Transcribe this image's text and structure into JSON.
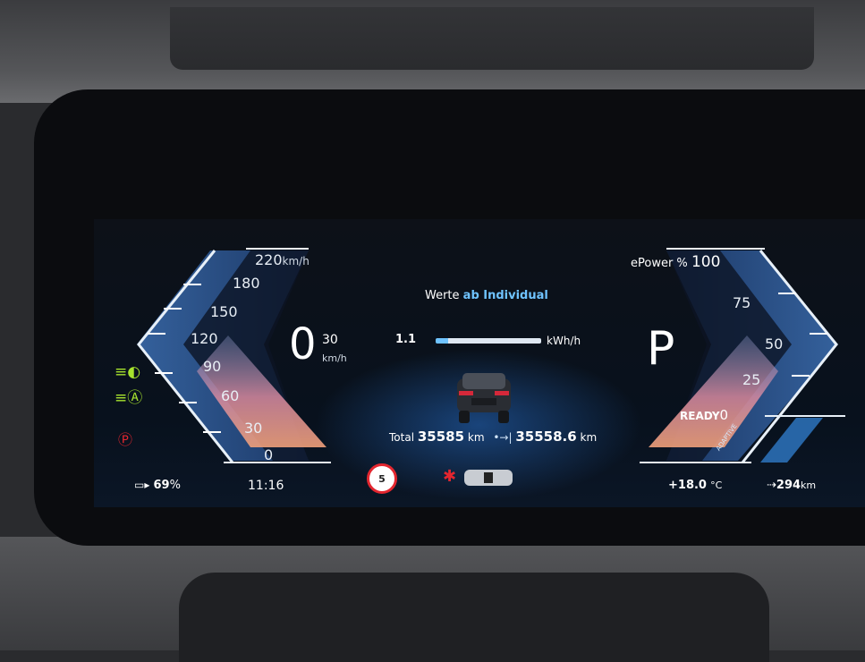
{
  "speedometer": {
    "ticks": [
      "220",
      "180",
      "150",
      "120",
      "90",
      "60",
      "30",
      "0"
    ],
    "max_unit": "km/h",
    "speed_value": "0",
    "speed_limit_set": "30",
    "speed_unit": "km/h"
  },
  "power_meter": {
    "title": "ePower %",
    "ticks": [
      "100",
      "75",
      "50",
      "25"
    ],
    "ready_label": "READY",
    "ready_value": "0",
    "mode_badge": "ADAPTIVE"
  },
  "center": {
    "header_prefix": "Werte",
    "header_mode": "ab Individual",
    "consumption_value": "1.1",
    "consumption_unit": "kWh/h",
    "gear": "P",
    "total_label": "Total",
    "total_value": "35585",
    "total_unit": "km",
    "trip_value": "35558.6",
    "trip_unit": "km"
  },
  "status_bar": {
    "battery_percent": "69",
    "battery_unit": "%",
    "time": "11:16",
    "speed_limit_sign": "5",
    "temperature": "+18.0",
    "temperature_unit": "°C",
    "range_value": "294",
    "range_unit": "km"
  },
  "indicators": [
    "low-beam-icon",
    "auto-high-beam-icon",
    "parking-brake-icon",
    "seatbelt-warning-icon"
  ],
  "colors": {
    "accent_blue": "#6fc3ff",
    "indicator_green": "#a6e22e",
    "warning_red": "#e3262f"
  }
}
